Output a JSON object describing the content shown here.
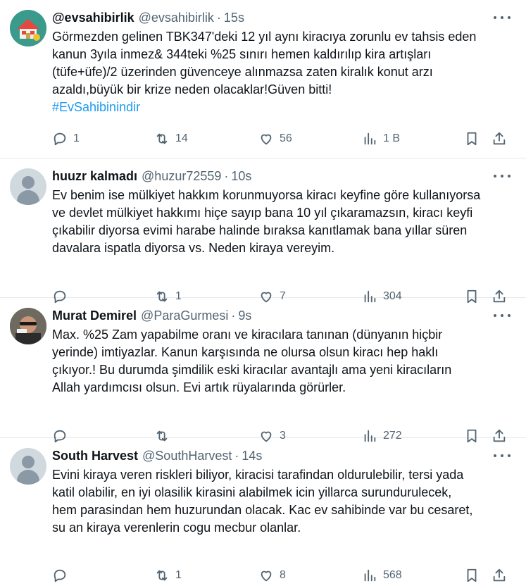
{
  "tweets": [
    {
      "name": "@evsahibirlik",
      "handle": "@evsahibirlik",
      "time": "15s",
      "text": "Görmezden gelinen TBK347'deki 12 yıl aynı kiracıya zorunlu ev tahsis eden\nkanun 3yıla inmez& 344teki %25 sınırı hemen kaldırılıp kira artışları\n(tüfe+üfe)/2 üzerinden güvenceye alınmazsa zaten kiralık konut arzı\nazaldı,büyük bir krize neden olacaklar!Güven bitti!",
      "hashtag": "#EvSahibinindir",
      "replies": "1",
      "retweets": "14",
      "likes": "56",
      "views": "1 B",
      "avatar": "house-logo-avatar"
    },
    {
      "name": "huuzr kalmadı",
      "handle": "@huzur72559",
      "time": "10s",
      "text": "Ev benim ise mülkiyet hakkım korunmuyorsa kiracı keyfine göre kullanıyorsa\nve devlet mülkiyet hakkımı hiçe sayıp bana 10 yıl çıkaramazsın, kiracı keyfi\nçıkabilir diyorsa evimi harabe halinde bıraksa kanıtlamak bana yıllar süren\ndavalara ispatla diyorsa  vs. Neden kiraya vereyim.",
      "hashtag": "",
      "replies": "",
      "retweets": "1",
      "likes": "7",
      "views": "304",
      "avatar": "default-avatar"
    },
    {
      "name": "Murat Demirel",
      "handle": "@ParaGurmesi",
      "time": "9s",
      "text": "Max. %25 Zam yapabilme oranı ve kiracılara tanınan (dünyanın hiçbir\nyerinde) imtiyazlar. Kanun karşısında ne olursa olsun kiracı hep haklı\nçıkıyor.! Bu durumda şimdilik eski kiracılar avantajlı ama yeni kiracıların\nAllah yardımcısı olsun. Evi artık rüyalarında görürler.",
      "hashtag": "",
      "replies": "",
      "retweets": "",
      "likes": "3",
      "views": "272",
      "avatar": "photo-avatar"
    },
    {
      "name": "South Harvest",
      "handle": "@SouthHarvest",
      "time": "14s",
      "text": "Evini kiraya veren riskleri biliyor, kiracisi tarafindan oldurulebilir, tersi yada\nkatil olabilir, en iyi olasilik kirasini alabilmek icin yillarca surundurulecek,\nhem parasindan hem huzurundan olacak. Kac ev sahibinde var bu cesaret,\nsu an kiraya verenlerin cogu mecbur olanlar.",
      "hashtag": "",
      "replies": "",
      "retweets": "1",
      "likes": "8",
      "views": "568",
      "avatar": "default-avatar"
    }
  ],
  "colors": {
    "text": "#0f1419",
    "secondary": "#536471",
    "link": "#1d9bf0",
    "divider": "#e6e9ec"
  },
  "icons": [
    "reply-icon",
    "retweet-icon",
    "like-icon",
    "views-icon",
    "bookmark-icon",
    "share-icon",
    "more-icon"
  ]
}
